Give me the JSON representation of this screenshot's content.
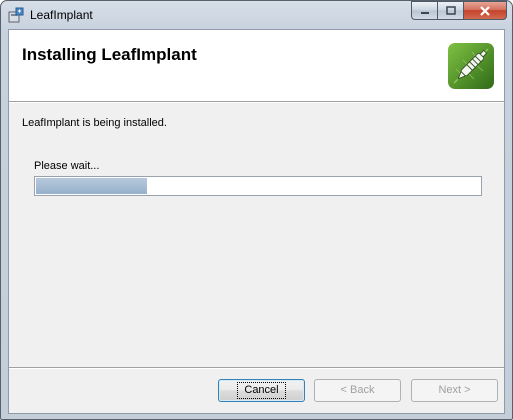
{
  "window": {
    "title": "LeafImplant"
  },
  "banner": {
    "heading": "Installing LeafImplant"
  },
  "body": {
    "status": "LeafImplant is being installed.",
    "wait_label": "Please wait...",
    "progress_fraction": 0.25
  },
  "buttons": {
    "cancel": "Cancel",
    "back": "< Back",
    "next": "Next >"
  },
  "colors": {
    "progress_fill": "#9db6cf",
    "logo_green": "#3f7d22"
  }
}
